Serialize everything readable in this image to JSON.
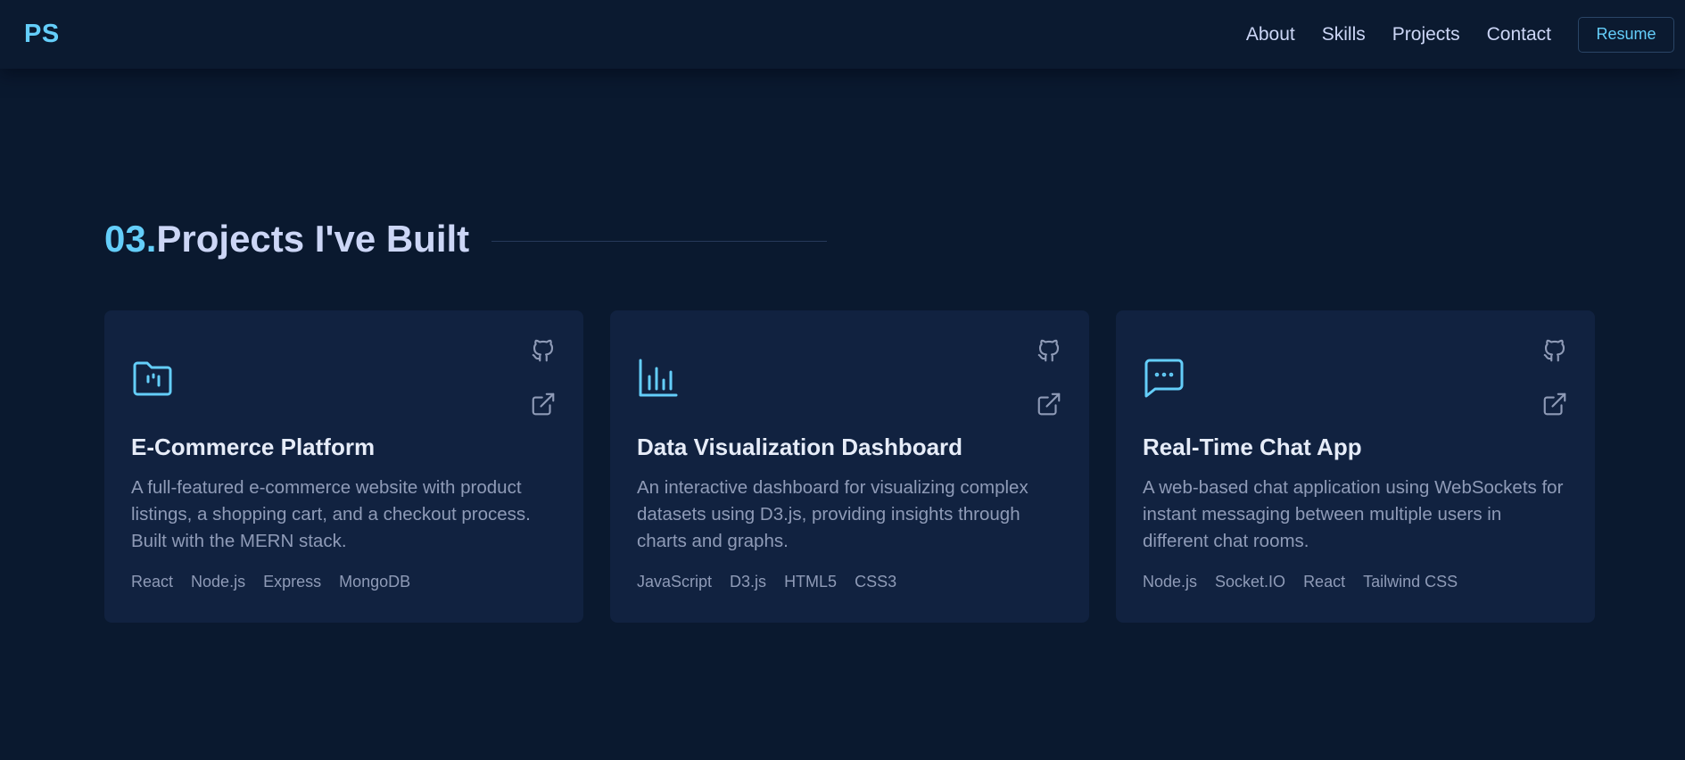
{
  "nav": {
    "logo": "PS",
    "links": [
      "About",
      "Skills",
      "Projects",
      "Contact"
    ],
    "resume_label": "Resume"
  },
  "section": {
    "number": "03.",
    "title": "Projects I've Built"
  },
  "colors": {
    "background": "#0a192f",
    "card": "#112240",
    "accent": "#64cefa",
    "heading": "#ccd6f6",
    "muted": "#8f9bb7"
  },
  "projects": [
    {
      "icon": "folder-icon",
      "title": "E-Commerce Platform",
      "description": "A full-featured e-commerce website with product listings, a shopping cart, and a checkout process. Built with the MERN stack.",
      "tags": [
        "React",
        "Node.js",
        "Express",
        "MongoDB"
      ]
    },
    {
      "icon": "bar-chart-icon",
      "title": "Data Visualization Dashboard",
      "description": "An interactive dashboard for visualizing complex datasets using D3.js, providing insights through charts and graphs.",
      "tags": [
        "JavaScript",
        "D3.js",
        "HTML5",
        "CSS3"
      ]
    },
    {
      "icon": "chat-bubble-icon",
      "title": "Real-Time Chat App",
      "description": "A web-based chat application using WebSockets for instant messaging between multiple users in different chat rooms.",
      "tags": [
        "Node.js",
        "Socket.IO",
        "React",
        "Tailwind CSS"
      ]
    }
  ]
}
